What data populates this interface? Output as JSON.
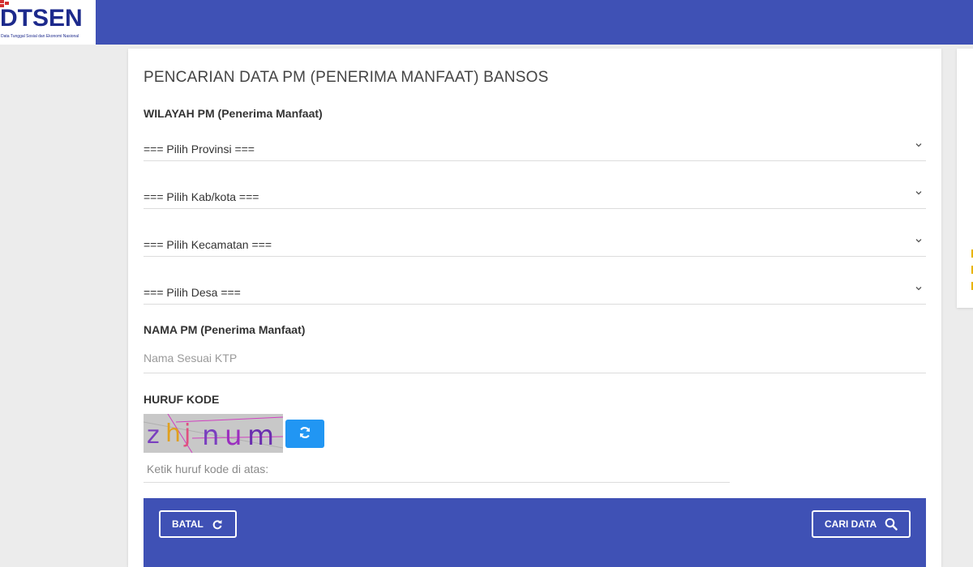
{
  "header": {
    "logo_text": "DTSEN",
    "logo_subtitle": "Data Tunggal Sosial dan Ekonomi Nasional",
    "accent_color": "#3f51b5"
  },
  "form": {
    "title": "PENCARIAN DATA PM (PENERIMA MANFAAT) BANSOS",
    "region_label": "WILAYAH PM (Penerima Manfaat)",
    "selects": [
      {
        "value": "=== Pilih Provinsi ==="
      },
      {
        "value": "=== Pilih Kab/kota ==="
      },
      {
        "value": "=== Pilih Kecamatan ==="
      },
      {
        "value": "=== Pilih Desa ==="
      }
    ],
    "name_label": "NAMA PM (Penerima Manfaat)",
    "name_placeholder": "Nama Sesuai KTP",
    "code_label": "HURUF KODE",
    "captcha_text": "zhjnum",
    "code_placeholder": "Ketik huruf kode di atas:",
    "cancel_label": "BATAL",
    "search_label": "CARI DATA",
    "refresh_color": "#2196f3"
  }
}
